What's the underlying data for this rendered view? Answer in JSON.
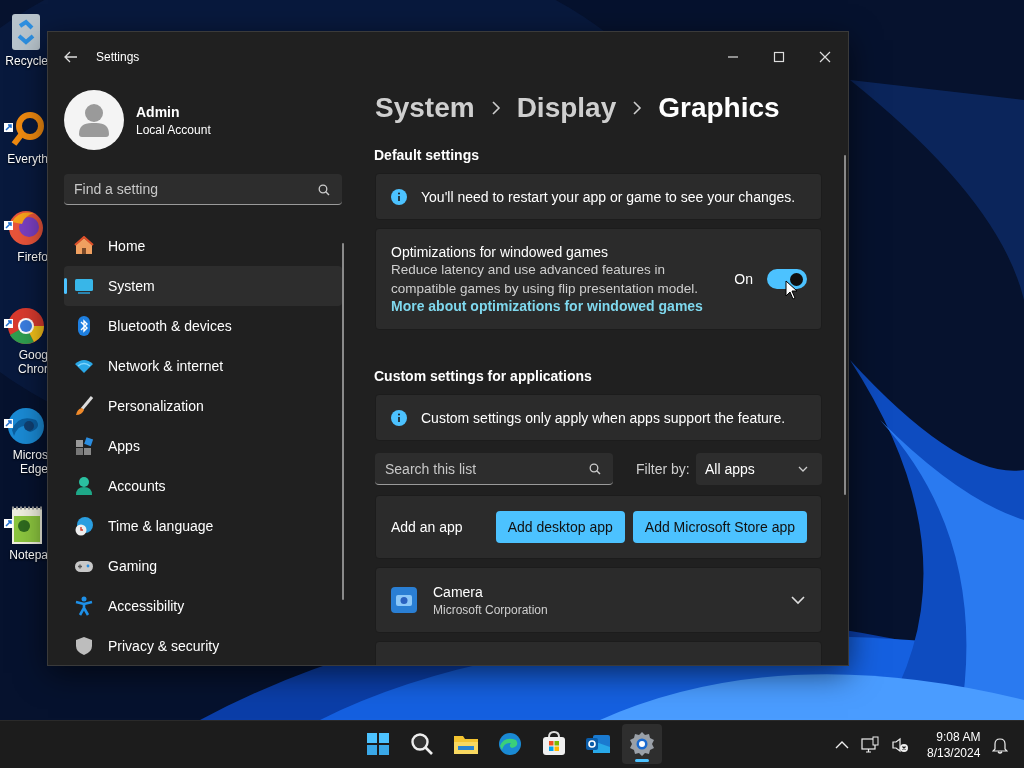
{
  "desktop": {
    "icons": [
      {
        "kind": "recycle",
        "label": [
          "Recycle"
        ]
      },
      {
        "kind": "everything",
        "label": [
          "Everyth"
        ]
      },
      {
        "kind": "firefox",
        "label": [
          "Firefo"
        ]
      },
      {
        "kind": "chrome",
        "label": [
          "Goog",
          "Chror"
        ]
      },
      {
        "kind": "edge",
        "label": [
          "Micros",
          "Edge"
        ]
      },
      {
        "kind": "notepad",
        "label": [
          "Notepa"
        ]
      }
    ]
  },
  "window": {
    "title": "Settings"
  },
  "account": {
    "name": "Admin",
    "type": "Local Account"
  },
  "search": {
    "placeholder": "Find a setting"
  },
  "sidebar": {
    "items": [
      {
        "label": "Home",
        "selected": false
      },
      {
        "label": "System",
        "selected": true
      },
      {
        "label": "Bluetooth & devices",
        "selected": false
      },
      {
        "label": "Network & internet",
        "selected": false
      },
      {
        "label": "Personalization",
        "selected": false
      },
      {
        "label": "Apps",
        "selected": false
      },
      {
        "label": "Accounts",
        "selected": false
      },
      {
        "label": "Time & language",
        "selected": false
      },
      {
        "label": "Gaming",
        "selected": false
      },
      {
        "label": "Accessibility",
        "selected": false
      },
      {
        "label": "Privacy & security",
        "selected": false
      }
    ]
  },
  "breadcrumb": [
    "System",
    "Display",
    "Graphics"
  ],
  "default_settings": {
    "heading": "Default settings",
    "info": "You'll need to restart your app or game to see your changes.",
    "option": {
      "title": "Optimizations for windowed games",
      "description": "Reduce latency and use advanced features in compatible games by using flip presentation model.",
      "link": "More about optimizations for windowed games",
      "toggle": {
        "label": "On",
        "on": true
      }
    }
  },
  "custom_settings": {
    "heading": "Custom settings for applications",
    "info": "Custom settings only apply when apps support the feature.",
    "search": {
      "placeholder": "Search this list"
    },
    "filter": {
      "label": "Filter by:",
      "value": "All apps"
    },
    "add_app": {
      "label": "Add an app",
      "buttons": [
        "Add desktop app",
        "Add Microsoft Store app"
      ]
    },
    "apps": [
      {
        "name": "Camera",
        "publisher": "Microsoft Corporation",
        "expanded": false
      }
    ]
  },
  "taskbar": {
    "apps": [
      {
        "kind": "start",
        "selected": false
      },
      {
        "kind": "search",
        "selected": false
      },
      {
        "kind": "folder",
        "selected": false
      },
      {
        "kind": "edge",
        "selected": false
      },
      {
        "kind": "store",
        "selected": false
      },
      {
        "kind": "outlook",
        "selected": false
      },
      {
        "kind": "settings",
        "selected": true
      }
    ],
    "time": "9:08 AM",
    "date": "8/13/2024"
  }
}
